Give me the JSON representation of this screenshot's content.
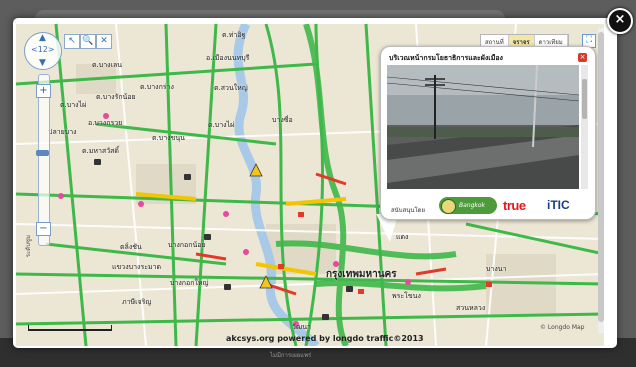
{
  "overlay": {
    "close_glyph": "×",
    "background_footer": "ไม่มีการเผยแพร่"
  },
  "toolbar": {
    "nav_center": "<12>",
    "zoom_in": "+",
    "zoom_out": "−",
    "tools": [
      "↖",
      "🔍",
      "✕"
    ],
    "layers": [
      "สถานที่",
      "จราจร",
      "ดาวเทียม"
    ],
    "active_layer": "จราจร",
    "fullscreen_glyph": "⛶",
    "side_label": "ระดับซูม"
  },
  "map": {
    "labels": [
      {
        "text": "ต.ท่าอิฐ",
        "kind": "small"
      },
      {
        "text": "อ.เมืองนนทบุรี",
        "kind": "small"
      },
      {
        "text": "ต.บางเลน",
        "kind": "small"
      },
      {
        "text": "ต.บางกร่าง",
        "kind": "small"
      },
      {
        "text": "ต.สวนใหญ่",
        "kind": "small"
      },
      {
        "text": "ต.บางรักน้อย",
        "kind": "small"
      },
      {
        "text": "ต.บางไผ่",
        "kind": "small"
      },
      {
        "text": "ปลายบาง",
        "kind": "small"
      },
      {
        "text": "อ.บางกรวย",
        "kind": "small"
      },
      {
        "text": "ต.บางขนุน",
        "kind": "small"
      },
      {
        "text": "ต.บางไผ่",
        "kind": "small"
      },
      {
        "text": "บางซื่อ",
        "kind": "small"
      },
      {
        "text": "ต.มหาสวัสดิ์",
        "kind": "small"
      },
      {
        "text": "ตลิ่งชัน",
        "kind": "small"
      },
      {
        "text": "บางกอกน้อย",
        "kind": "small"
      },
      {
        "text": "แขวงบางระมาด",
        "kind": "small"
      },
      {
        "text": "บางกอกใหญ่",
        "kind": "small"
      },
      {
        "text": "ภาษีเจริญ",
        "kind": "small"
      },
      {
        "text": "กรุงเทพมหานคร",
        "kind": "big"
      },
      {
        "text": "พระโขนง",
        "kind": "small"
      },
      {
        "text": "สวนหลวง",
        "kind": "small"
      },
      {
        "text": "บางนา",
        "kind": "small"
      },
      {
        "text": "แดง",
        "kind": "small"
      },
      {
        "text": "วัฒนา",
        "kind": "small"
      }
    ],
    "credit": "akcsys.org powered by longdo traffic©2013",
    "copyright": "© Longdo Map"
  },
  "popup": {
    "title": "บริเวณหน้ากรมโยธาธิการและผังเมือง",
    "close_glyph": "×",
    "sponsor_label": "สนับสนุนโดย",
    "sponsors": {
      "bangkok": "Bangkok",
      "true": "true",
      "itic": "iTIC"
    }
  },
  "colors": {
    "traffic_free": "#3fb84a",
    "traffic_slow": "#f2c500",
    "traffic_jam": "#e23a2a",
    "river": "#a8c9e8",
    "map_bg": "#ece6d4"
  }
}
